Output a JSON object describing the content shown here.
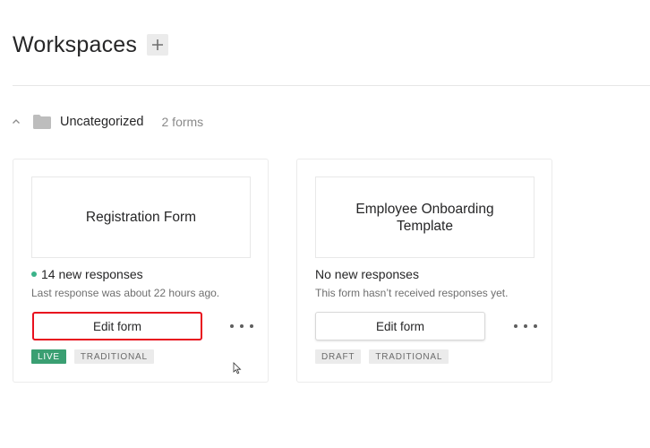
{
  "header": {
    "title": "Workspaces",
    "add_icon": "plus-icon"
  },
  "folder": {
    "expand_icon": "chevron-up-icon",
    "folder_icon": "folder-icon",
    "name": "Uncategorized",
    "count": "2 forms"
  },
  "forms": [
    {
      "title": "Registration Form",
      "responses": "14 new responses",
      "has_new": true,
      "subtext": "Last response was about 22 hours ago.",
      "edit_label": "Edit form",
      "status": "LIVE",
      "type": "TRADITIONAL",
      "highlighted": true
    },
    {
      "title": "Employee Onboarding Template",
      "responses": "No new responses",
      "has_new": false,
      "subtext": "This form hasn’t received responses yet.",
      "edit_label": "Edit form",
      "status": "DRAFT",
      "type": "TRADITIONAL",
      "highlighted": false
    }
  ],
  "colors": {
    "live_badge": "#3a9f72",
    "new_dot": "#3bb38a",
    "highlight_border": "#e8101e"
  }
}
